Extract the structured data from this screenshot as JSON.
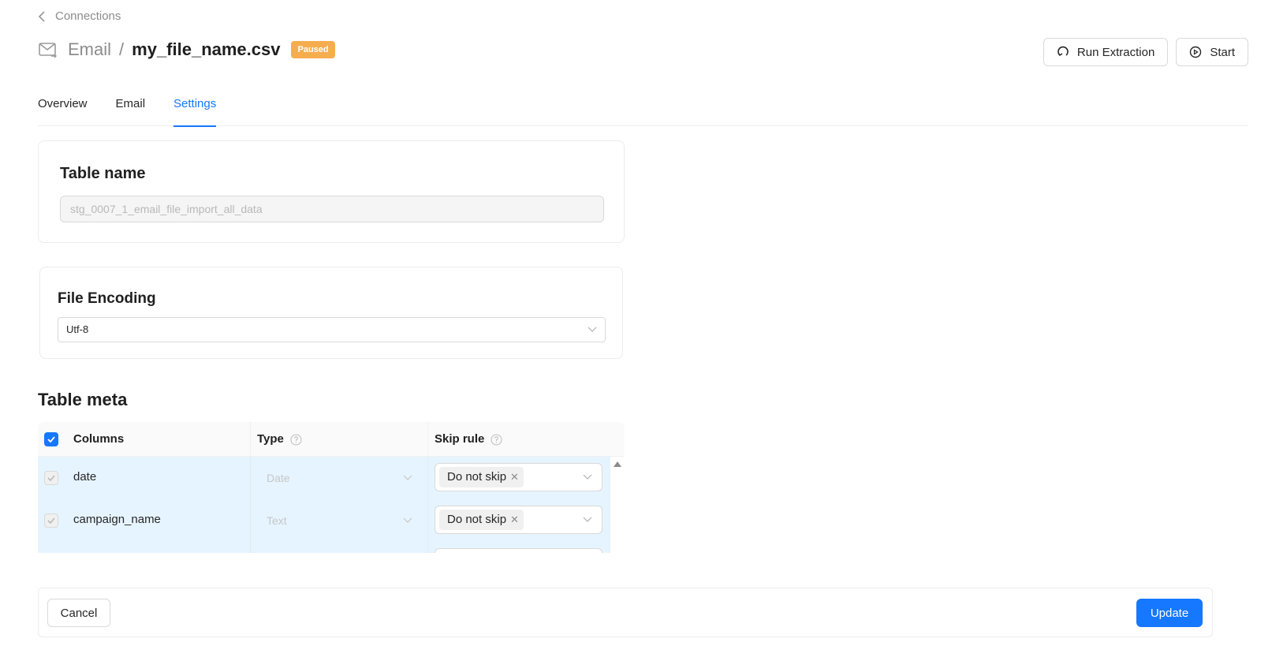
{
  "breadcrumb": {
    "back_label": "Connections",
    "back_icon": "chevron-left-icon"
  },
  "header": {
    "source_icon": "mail-icon",
    "source": "Email",
    "separator": "/",
    "file_name": "my_file_name.csv",
    "status_badge": "Paused",
    "status_color": "#f6ad4e"
  },
  "actions": {
    "run_extraction_label": "Run Extraction",
    "run_extraction_icon": "refresh-icon",
    "start_label": "Start",
    "start_icon": "play-circle-icon"
  },
  "tabs": [
    {
      "label": "Overview",
      "active": false
    },
    {
      "label": "Email",
      "active": false
    },
    {
      "label": "Settings",
      "active": true
    }
  ],
  "table_name_card": {
    "title": "Table name",
    "value": "stg_0007_1_email_file_import_all_data"
  },
  "file_encoding_card": {
    "title": "File Encoding",
    "selected": "Utf-8"
  },
  "table_meta": {
    "title": "Table meta",
    "columns_header": "Columns",
    "type_header": "Type",
    "skip_rule_header": "Skip rule",
    "select_all_checked": true,
    "rows": [
      {
        "name": "date",
        "type": "Date",
        "skip_rule": "Do not skip",
        "checked": true
      },
      {
        "name": "campaign_name",
        "type": "Text",
        "skip_rule": "Do not skip",
        "checked": true
      }
    ]
  },
  "footer": {
    "cancel_label": "Cancel",
    "update_label": "Update"
  },
  "colors": {
    "accent": "#1677ff",
    "row_selected_bg": "#e6f4ff"
  }
}
